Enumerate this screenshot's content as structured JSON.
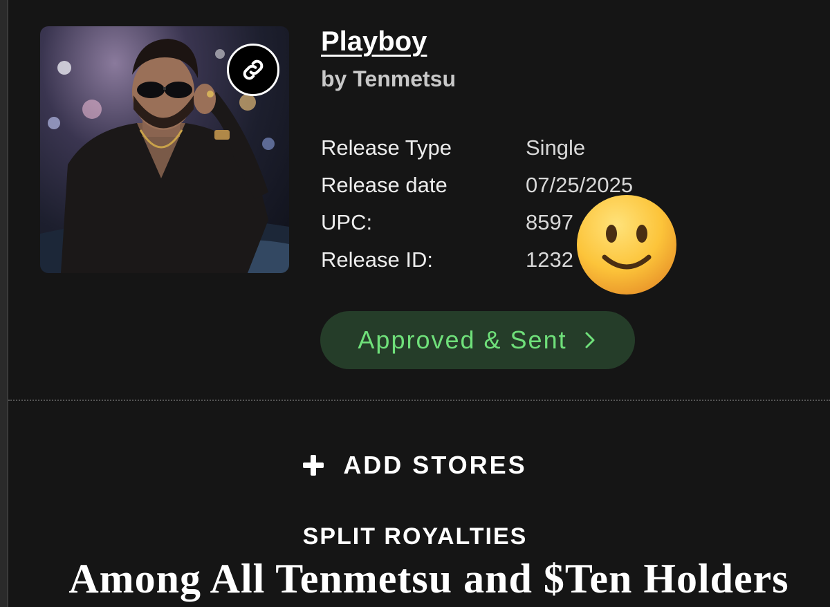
{
  "release": {
    "title": "Playboy",
    "artist": "by Tenmetsu",
    "cover_icon": "link-icon",
    "details": [
      {
        "label": "Release Type",
        "value": "Single"
      },
      {
        "label": "Release date",
        "value": "07/25/2025"
      },
      {
        "label": "UPC:",
        "value": "8597        42"
      },
      {
        "label": "Release ID:",
        "value": "1232"
      }
    ],
    "status_label": "Approved & Sent",
    "status_icon": "chevron-right-icon"
  },
  "actions": {
    "add_stores_label": "ADD STORES",
    "add_icon": "plus-icon",
    "split_royalties_label": "SPLIT ROYALTIES"
  },
  "overlay": {
    "caption": "Among All Tenmetsu and $Ten Holders",
    "emoji_icon": "slightly-smiling-face-emoji"
  },
  "colors": {
    "background": "#151515",
    "status_bg": "#253d29",
    "status_text": "#6fe07a"
  }
}
